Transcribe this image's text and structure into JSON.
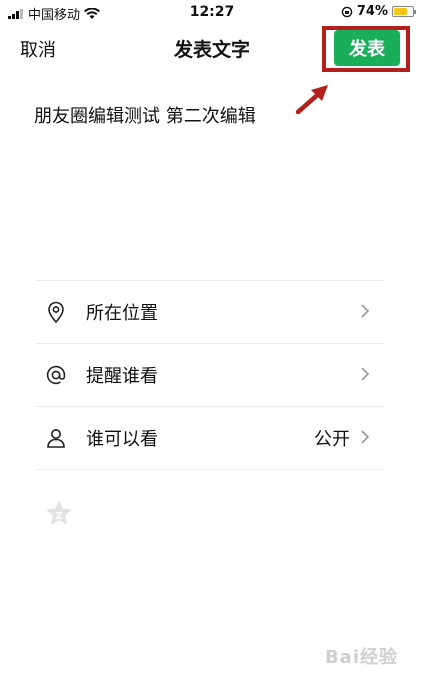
{
  "status_bar": {
    "carrier": "中国移动",
    "time": "12:27",
    "battery": "74%",
    "battery_level": 0.74
  },
  "nav": {
    "cancel_label": "取消",
    "title": "发表文字",
    "publish_label": "发表",
    "publish_color": "#1aad5a",
    "highlight_color": "#b3201b"
  },
  "post": {
    "text": "朋友圈编辑测试 第二次编辑"
  },
  "options": [
    {
      "label": "所在位置",
      "icon": "location-pin-icon",
      "value": ""
    },
    {
      "label": "提醒谁看",
      "icon": "at-icon",
      "value": ""
    },
    {
      "label": "谁可以看",
      "icon": "person-icon",
      "value": "公开"
    }
  ],
  "extra": {
    "icon": "star-icon"
  },
  "watermark": {
    "text": "Bai经验"
  }
}
